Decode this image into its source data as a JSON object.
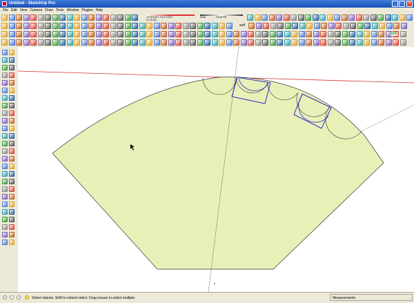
{
  "window": {
    "title": "Untitled - SketchUp Pro"
  },
  "menu": [
    "File",
    "Edit",
    "View",
    "Camera",
    "Draw",
    "Tools",
    "Window",
    "Plugins",
    "Help"
  ],
  "shadow": {
    "time_label": "07:20 AM",
    "noon_label": "Noon",
    "end_label": "04:46 PM",
    "months": "J F M A M J J A S O N D"
  },
  "toolbar": {
    "soften_label": "soft",
    "svg_label": "SVG"
  },
  "status": {
    "message": "Select objects. Shift to extend select. Drag mouse to select multiple.",
    "measurements_label": "Measurements"
  },
  "colors": {
    "face": "#e8f0b8",
    "red_axis": "#d23030",
    "selection": "#2828c8",
    "title_blue": "#2a62c9"
  }
}
